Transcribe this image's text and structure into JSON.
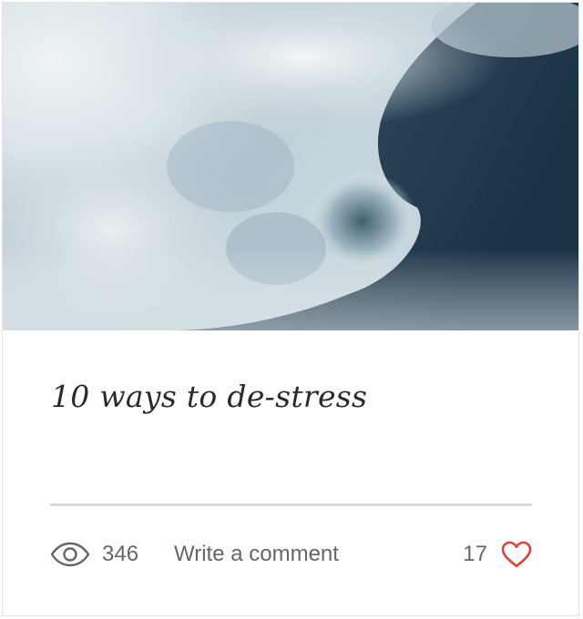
{
  "post": {
    "title": "10 ways to de-stress",
    "views": "346",
    "comment_label": "Write a comment",
    "likes": "17"
  },
  "icons": {
    "views": "eye-icon",
    "like": "heart-outline-icon"
  },
  "colors": {
    "heart": "#e0403a",
    "divider": "#d9d9d9",
    "text": "#666666"
  }
}
